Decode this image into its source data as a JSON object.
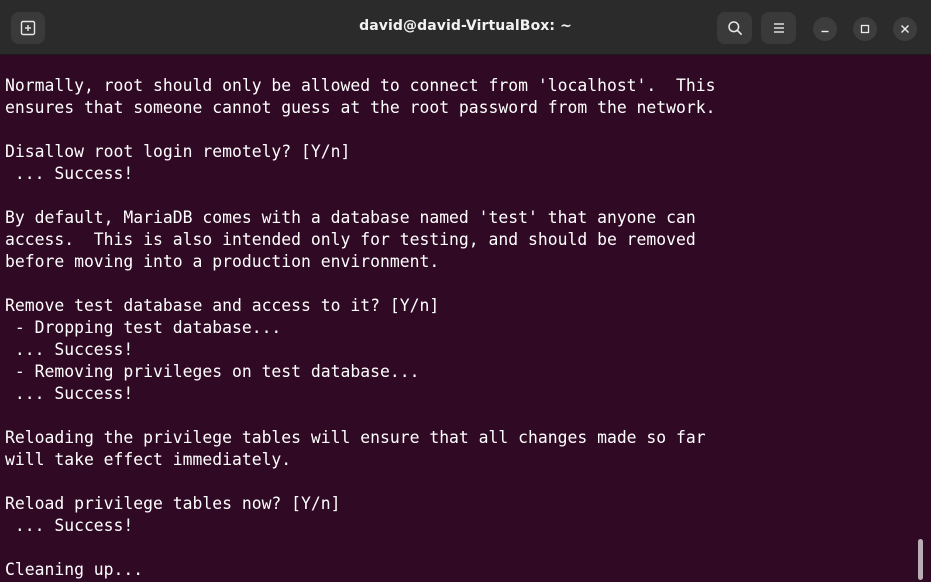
{
  "window": {
    "title": "david@david-VirtualBox: ~"
  },
  "toolbar": {
    "new_tab_icon": "new-tab-icon",
    "search_icon": "search-icon",
    "menu_icon": "hamburger-menu-icon",
    "minimize_icon": "minimize-icon",
    "maximize_icon": "maximize-icon",
    "close_icon": "close-icon"
  },
  "terminal": {
    "lines": [
      "Normally, root should only be allowed to connect from 'localhost'.  This",
      "ensures that someone cannot guess at the root password from the network.",
      "",
      "Disallow root login remotely? [Y/n]",
      " ... Success!",
      "",
      "By default, MariaDB comes with a database named 'test' that anyone can",
      "access.  This is also intended only for testing, and should be removed",
      "before moving into a production environment.",
      "",
      "Remove test database and access to it? [Y/n]",
      " - Dropping test database...",
      " ... Success!",
      " - Removing privileges on test database...",
      " ... Success!",
      "",
      "Reloading the privilege tables will ensure that all changes made so far",
      "will take effect immediately.",
      "",
      "Reload privilege tables now? [Y/n]",
      " ... Success!",
      "",
      "Cleaning up..."
    ]
  },
  "colors": {
    "terminal_bg": "#300a24",
    "titlebar_bg": "#2b2b2b",
    "text": "#ffffff"
  }
}
